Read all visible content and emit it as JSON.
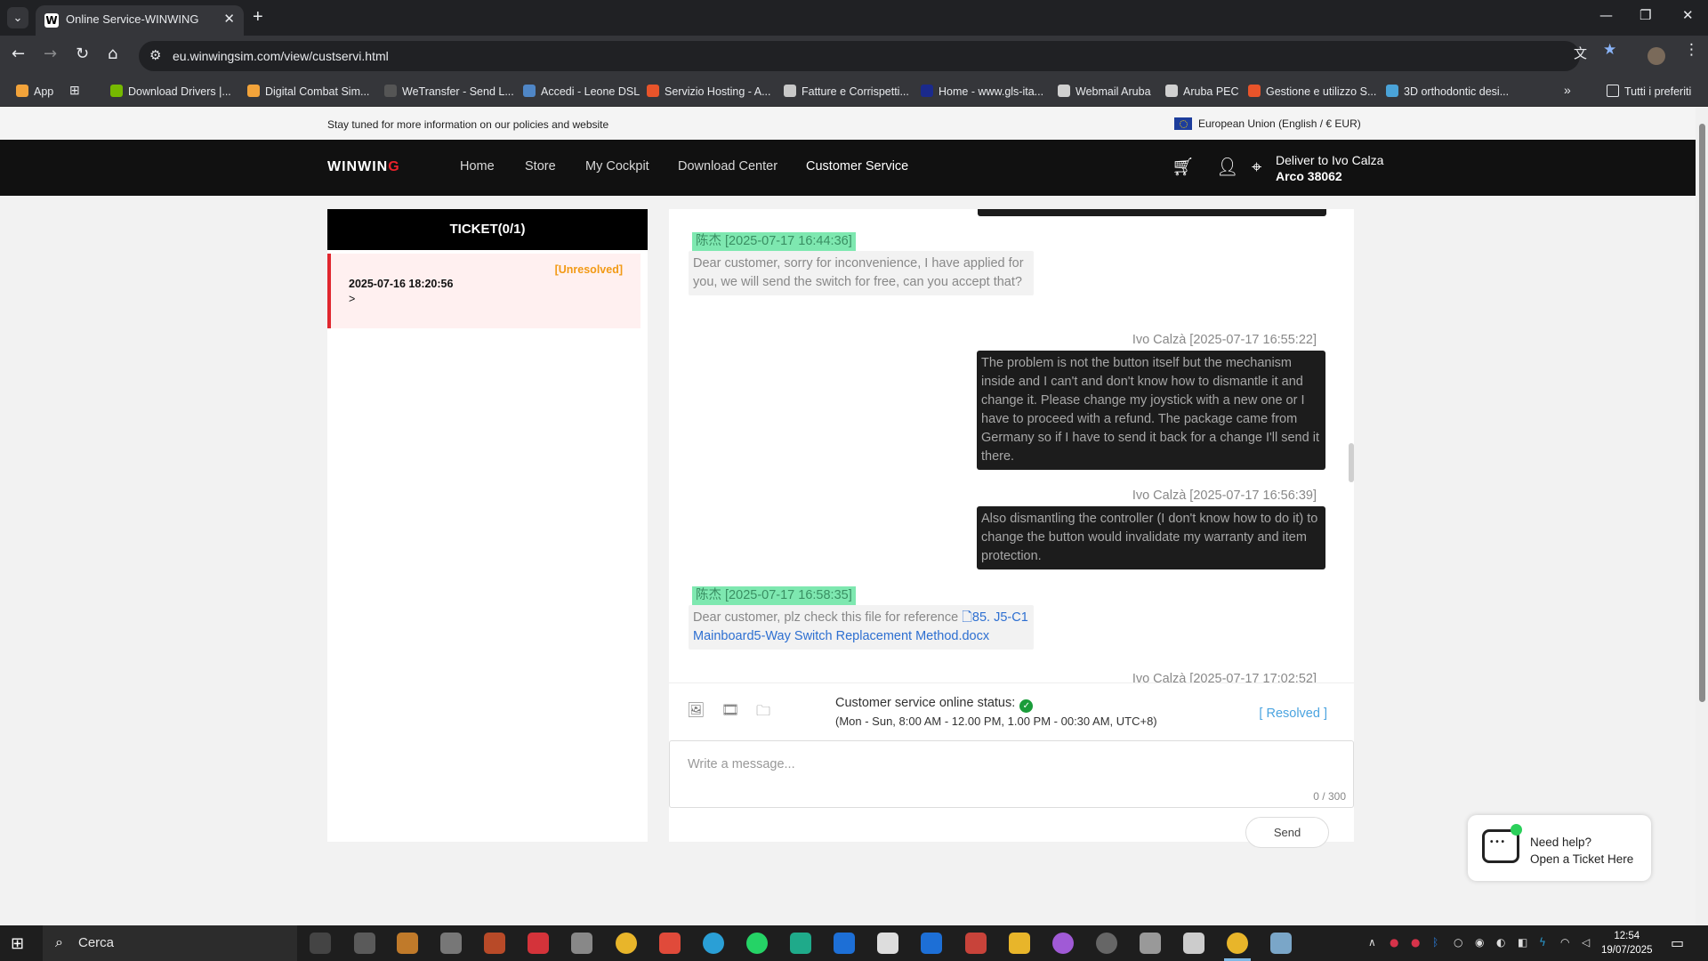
{
  "browser": {
    "tab_title": "Online Service-WINWING",
    "tab_favicon_letter": "W",
    "url": "eu.winwingsim.com/view/custservi.html",
    "bookmarks": [
      {
        "label": "App",
        "color": "#f2a33a"
      },
      {
        "label": "Download Drivers |...",
        "color": "#76b900"
      },
      {
        "label": "Digital Combat Sim...",
        "color": "#f2a33a"
      },
      {
        "label": "WeTransfer - Send L...",
        "color": "#555555"
      },
      {
        "label": "Accedi - Leone DSL",
        "color": "#4f86c6"
      },
      {
        "label": "Servizio Hosting - A...",
        "color": "#e8542a"
      },
      {
        "label": "Fatture e Corrispetti...",
        "color": "#c8c8c8"
      },
      {
        "label": "Home - www.gls-ita...",
        "color": "#1b2a8c"
      },
      {
        "label": "Webmail Aruba",
        "color": "#d0d0d0"
      },
      {
        "label": "Aruba PEC",
        "color": "#d0d0d0"
      },
      {
        "label": "Gestione e utilizzo S...",
        "color": "#e8542a"
      },
      {
        "label": "3D orthodontic desi...",
        "color": "#4aa3d8"
      }
    ],
    "bookmarks_folder": "Tutti i preferiti"
  },
  "site": {
    "notice": "Stay tuned for more information on our policies and website",
    "region": "European Union (English / € EUR)",
    "logo_main": "WINWIN",
    "logo_accent": "G",
    "nav": [
      "Home",
      "Store",
      "My Cockpit",
      "Download Center",
      "Customer Service"
    ],
    "deliver_line1": "Deliver to Ivo Calza",
    "deliver_line2": "Arco 38062"
  },
  "tickets": {
    "header": "TICKET(0/1)",
    "items": [
      {
        "status": "[Unresolved]",
        "date": "2025-07-16 18:20:56",
        "arrow": ">"
      }
    ]
  },
  "chat": {
    "messages": [
      {
        "sender": "陈杰",
        "time": "[2025-07-17 16:44:36]",
        "side": "agent",
        "text": "Dear customer, sorry for inconvenience, I have applied for you, we will send the switch for free, can you accept that?"
      },
      {
        "sender": "Ivo Calzà",
        "time": "[2025-07-17 16:55:22]",
        "side": "user",
        "text": "The problem is not the button itself but the mechanism inside and I can't and don't know how to dismantle it and change it. Please change my joystick with a new one or I have to proceed with a refund. The package came from Germany so if I have to send it back for a change I'll send it there."
      },
      {
        "sender": "Ivo Calzà",
        "time": "[2025-07-17 16:56:39]",
        "side": "user",
        "text": "Also dismantling the controller (I don't know how to do it) to change the button would invalidate my warranty and item protection."
      },
      {
        "sender": "陈杰",
        "time": "[2025-07-17 16:58:35]",
        "side": "agent",
        "text": "Dear customer, plz check this file for reference",
        "file": "85. J5-C1 Mainboard5-Way Switch Replacement Method.docx"
      },
      {
        "sender": "Ivo Calzà",
        "time": "[2025-07-17 17:02:52]",
        "side": "user",
        "text": ""
      }
    ],
    "online_status_label": "Customer service online status:",
    "online_hours": "(Mon - Sun, 8:00 AM - 12.00 PM, 1.00 PM - 00:30 AM, UTC+8)",
    "resolved_label": "[ Resolved ]",
    "input_placeholder": "Write a message...",
    "char_count": "0 / 300",
    "send_label": "Send"
  },
  "help_widget": {
    "line1": "Need help?",
    "line2": "Open a Ticket Here"
  },
  "taskbar": {
    "search_label": "Cerca",
    "time": "12:54",
    "date": "19/07/2025"
  }
}
